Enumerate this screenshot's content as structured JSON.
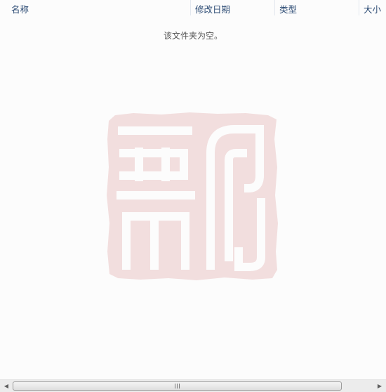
{
  "columns": {
    "name": "名称",
    "date_modified": "修改日期",
    "type": "类型",
    "size": "大小"
  },
  "sort_indicator": "^",
  "empty_message": "该文件夹为空。",
  "colors": {
    "header_text": "#2b4a73",
    "background": "#fcfcfc",
    "seal": "#f2dede"
  },
  "icons": {
    "seal_watermark": "seal-stamp-icon",
    "scroll_left": "triangle-left-icon",
    "scroll_right": "triangle-right-icon",
    "thumb_grip": "grip-icon"
  }
}
